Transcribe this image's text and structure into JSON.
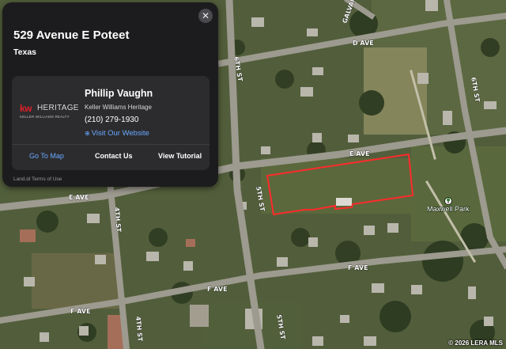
{
  "card": {
    "title": "529 Avenue E Poteet",
    "state": "Texas",
    "close_icon": "close-icon",
    "agent": {
      "logo_mark": "kw",
      "logo_name": "HERITAGE",
      "logo_subtext": "KELLER WILLIAMS REALTY",
      "name": "Phillip Vaughn",
      "brokerage": "Keller Williams Heritage",
      "phone": "(210) 279-1930",
      "website_icon": "globe-icon",
      "website_label": "Visit Our Website"
    },
    "actions": {
      "goto_map": "Go To Map",
      "contact": "Contact Us",
      "tutorial": "View Tutorial"
    },
    "footer": "Land.id Terms of Use"
  },
  "map": {
    "streets": {
      "d_ave": "D AVE",
      "e_ave": "E AVE",
      "e_ave_west": "E AVE",
      "f_ave": "F AVE",
      "f_ave_west": "F AVE",
      "f_ave_far": "F AVE",
      "galvan_rd": "GALVAN RD",
      "st_6th_north": "6TH ST",
      "st_6th_east": "6TH ST",
      "st_5th": "5TH ST",
      "st_5th_south": "5TH ST",
      "st_4th": "4TH ST",
      "st_4th_south": "4TH ST"
    },
    "park_label": "Maxwell Park",
    "park_icon": "tree-icon",
    "parcel_outline_color": "#ff2a2a"
  },
  "copyright": "© 2026 LERA MLS"
}
